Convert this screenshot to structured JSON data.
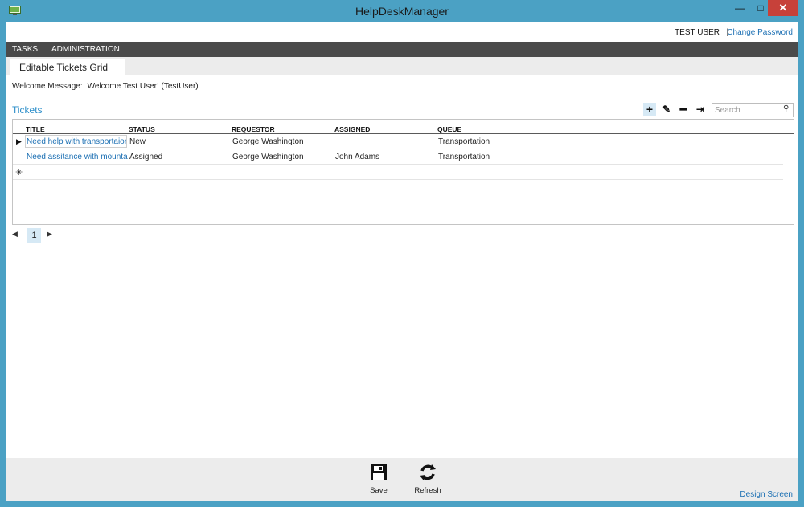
{
  "window": {
    "title": "HelpDeskManager",
    "icon": "app-icon",
    "controls": {
      "minimize": "—",
      "maximize": "□",
      "close": "✕"
    }
  },
  "userbar": {
    "user": "TEST USER",
    "separator": "|",
    "change_password": "Change Password"
  },
  "menu": {
    "items": [
      {
        "label": "TASKS"
      },
      {
        "label": "ADMINISTRATION"
      }
    ]
  },
  "tabs": [
    {
      "label": "Editable Tickets Grid"
    }
  ],
  "welcome": {
    "label": "Welcome Message:",
    "value": "Welcome Test User! (TestUser)"
  },
  "section": {
    "title": "Tickets"
  },
  "toolbar": {
    "add_icon": "+",
    "edit_icon": "✎",
    "delete_icon": "━",
    "open_icon": "⇥",
    "search_placeholder": "Search",
    "search_icon": "⚲"
  },
  "grid": {
    "columns": [
      "TITLE",
      "STATUS",
      "REQUESTOR",
      "ASSIGNED",
      "QUEUE"
    ],
    "rows": [
      {
        "title": "Need help with transportaion",
        "status": "New",
        "requestor": "George Washington",
        "assigned": "",
        "queue": "Transportation"
      },
      {
        "title": "Need assitance with mountain",
        "status": "Assigned",
        "requestor": "George Washington",
        "assigned": "John Adams",
        "queue": "Transportation"
      }
    ],
    "current_row_indicator": "▶",
    "new_row_icon": "✳"
  },
  "pager": {
    "prev": "◀",
    "page": "1",
    "next": "▶"
  },
  "footer": {
    "save": "Save",
    "refresh": "Refresh",
    "design_screen": "Design Screen"
  },
  "colors": {
    "window_frame": "#4ba1c4",
    "menu_bar": "#4a4a4a",
    "link": "#1b6fb3",
    "accent": "#2a8dc9",
    "close_button": "#c7413a"
  }
}
